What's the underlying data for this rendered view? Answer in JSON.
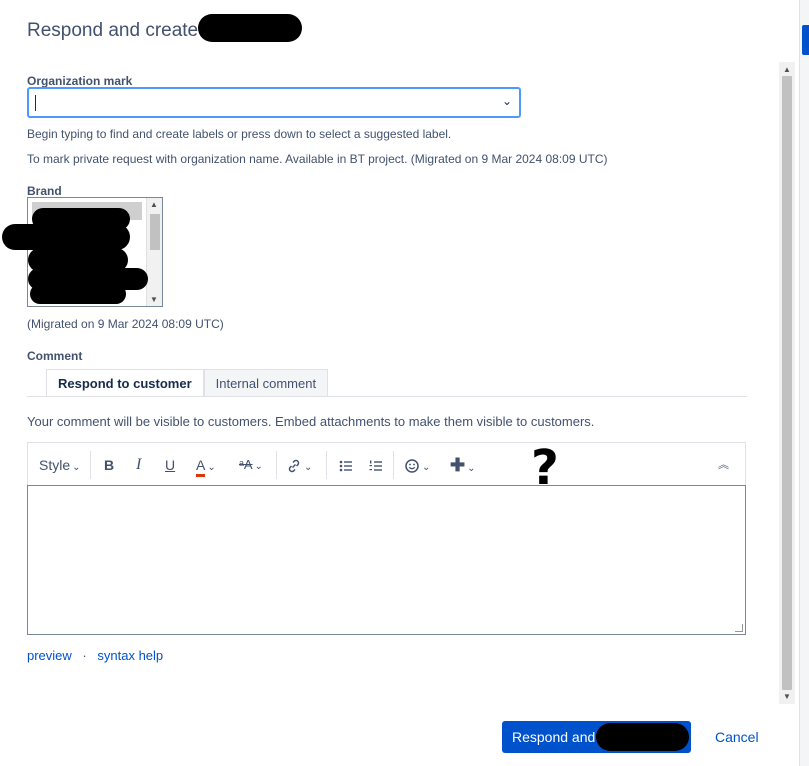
{
  "dialog": {
    "title": "Respond and create"
  },
  "organization_mark": {
    "label": "Organization mark",
    "value": "",
    "help_1": "Begin typing to find and create labels or press down to select a suggested label.",
    "help_2": "To mark private request with organization name. Available in BT project. (Migrated on 9 Mar 2024 08:09 UTC)"
  },
  "brand": {
    "label": "Brand",
    "note": "(Migrated on 9 Mar 2024 08:09 UTC)"
  },
  "comment": {
    "label": "Comment",
    "tabs": [
      "Respond to customer",
      "Internal comment"
    ],
    "notice": "Your comment will be visible to customers. Embed attachments to make them visible to customers.",
    "toolbar": {
      "style_label": "Style",
      "bold": "B",
      "italic": "I",
      "underline": "U",
      "text_color": "A",
      "more_formatting": "ᵃA"
    },
    "links": {
      "preview": "preview",
      "separator": "·",
      "syntax_help": "syntax help"
    }
  },
  "annotation": {
    "mark": "?"
  },
  "footer": {
    "submit_label": "Respond and c",
    "cancel_label": "Cancel"
  },
  "colors": {
    "primary": "#0052cc",
    "focus_border": "#4c9aff",
    "text_color_underline": "#de350b"
  }
}
